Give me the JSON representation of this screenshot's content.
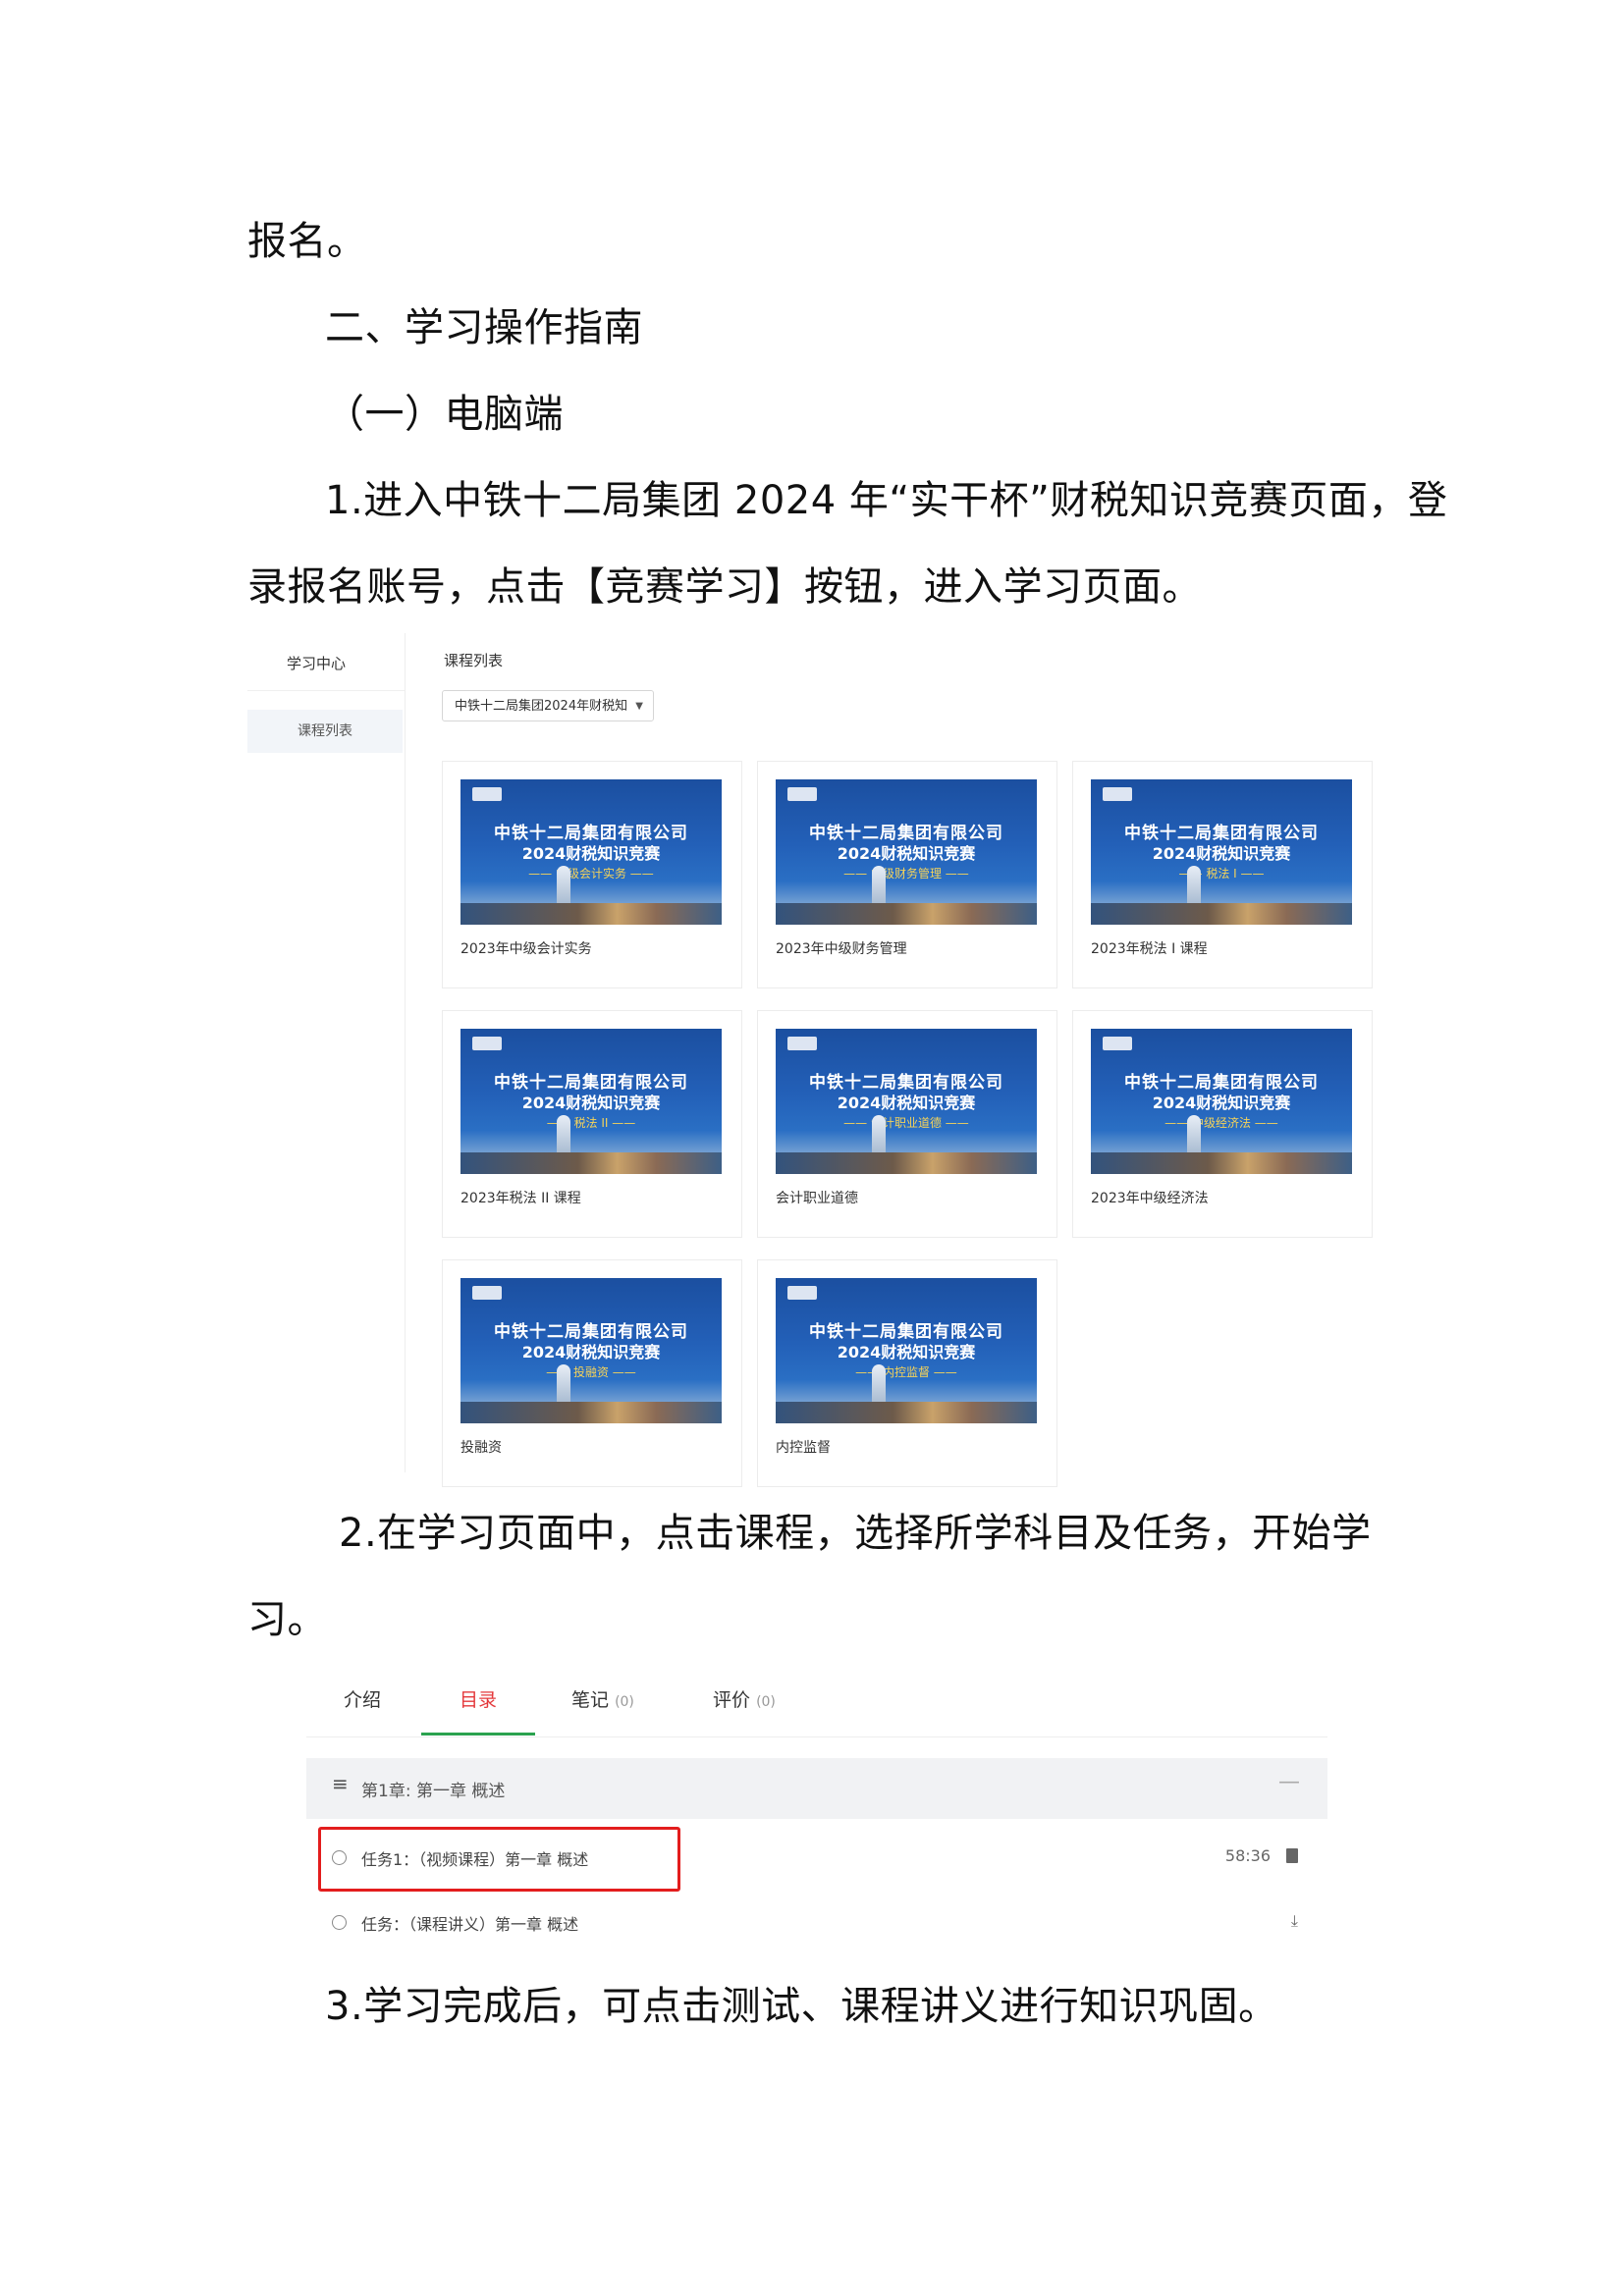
{
  "paragraphs": {
    "p1": "报名。",
    "p2": "二、学习操作指南",
    "p3": "（一）电脑端",
    "p4a": "1.进入中铁十二局集团 2024 年“实干杯”财税知识竞赛页面，登",
    "p4b": "录报名账号，点击【竞赛学习】按钮，进入学习页面。",
    "p5a": "2.在学习页面中，点击课程，选择所学科目及任务，开始学",
    "p5b": "习。",
    "p6": "3.学习完成后，可点击测试、课程讲义进行知识巩固。"
  },
  "course_list": {
    "sidebar_title": "学习中心",
    "sidebar_item": "课程列表",
    "title": "课程列表",
    "select_value": "中铁十二局集团2024年财税知",
    "banner_line1": "中铁十二局集团有限公司",
    "banner_line2": "2024财税知识竞赛",
    "cards": [
      {
        "subject": "—— 中级会计实务 ——",
        "label": "2023年中级会计实务"
      },
      {
        "subject": "—— 中级财务管理 ——",
        "label": "2023年中级财务管理"
      },
      {
        "subject": "—— 税法 I ——",
        "label": "2023年税法 I 课程"
      },
      {
        "subject": "—— 税法 II ——",
        "label": "2023年税法 II 课程"
      },
      {
        "subject": "—— 会计职业道德 ——",
        "label": "会计职业道德"
      },
      {
        "subject": "—— 中级经济法 ——",
        "label": "2023年中级经济法"
      },
      {
        "subject": "—— 投融资 ——",
        "label": "投融资"
      },
      {
        "subject": "—— 内控监督 ——",
        "label": "内控监督"
      }
    ]
  },
  "catalog": {
    "tabs": [
      {
        "label": "介绍",
        "count": ""
      },
      {
        "label": "目录",
        "count": ""
      },
      {
        "label": "笔记",
        "count": "(0)"
      },
      {
        "label": "评价",
        "count": "(0)"
      }
    ],
    "chapter": "第1章: 第一章 概述",
    "tasks": [
      {
        "text": "任务1：（视频课程）第一章 概述",
        "meta": "58:36"
      },
      {
        "text": "任务：（课程讲义）第一章 概述",
        "meta": ""
      }
    ]
  },
  "colors": {
    "accent_red": "#e31d1d",
    "tab_active": "#e4393c",
    "tab_underline": "#2aa24f",
    "banner_blue": "#1b4fa0"
  }
}
